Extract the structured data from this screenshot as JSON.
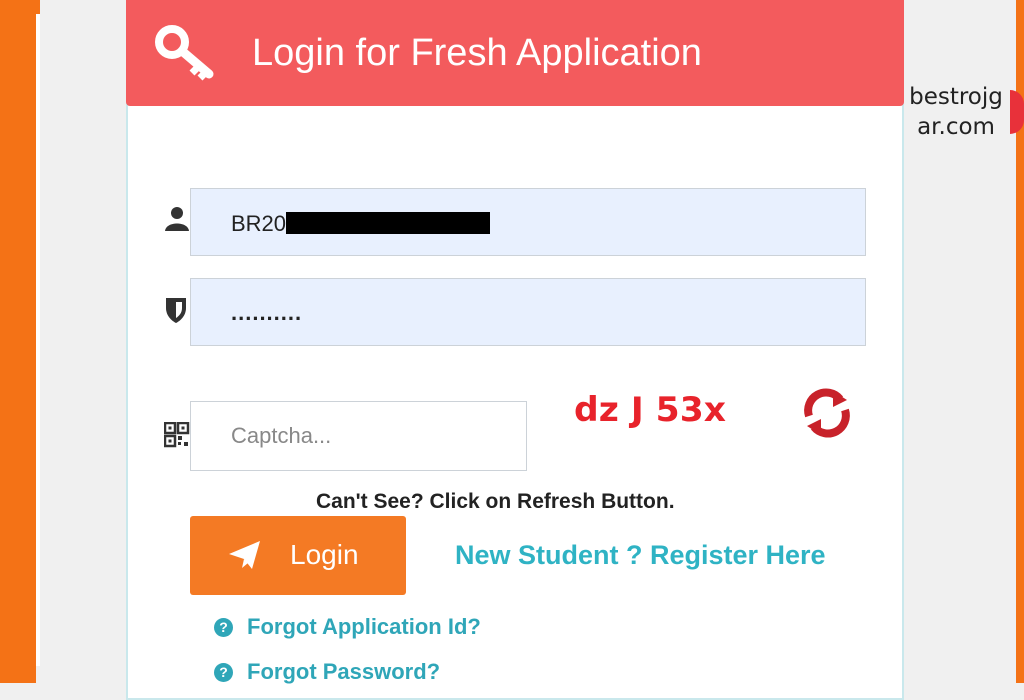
{
  "header": {
    "title": "Login for Fresh Application",
    "icon": "key-icon"
  },
  "watermark": "bestrojgar.com",
  "form": {
    "username_value": "BR20",
    "password_value": "..........",
    "captcha_placeholder": "Captcha...",
    "captcha_text": "dz J 53x",
    "hint": "Can't See? Click on Refresh Button."
  },
  "actions": {
    "login_label": "Login",
    "register_label": "New Student ? Register Here",
    "forgot_id_label": "Forgot Application Id?",
    "forgot_password_label": "Forgot Password?"
  },
  "colors": {
    "header_bg": "#f35b5d",
    "accent_orange": "#f47a24",
    "link_teal": "#2fb3c4",
    "captcha_red": "#e8232b"
  }
}
